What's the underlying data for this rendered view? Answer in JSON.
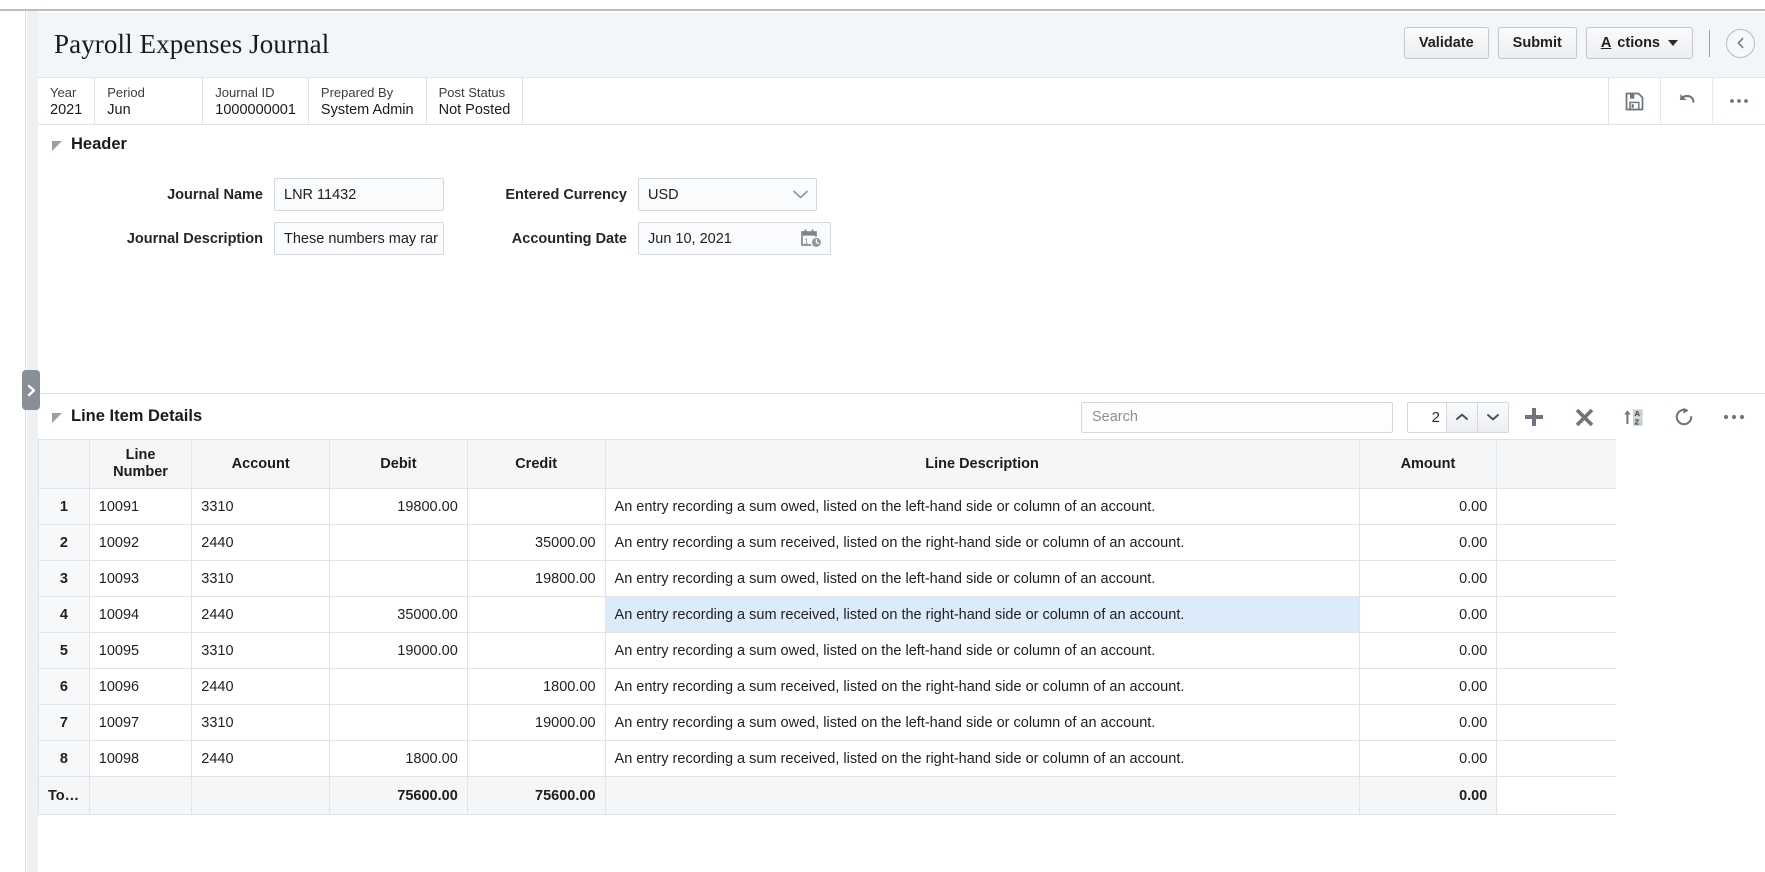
{
  "page": {
    "title": "Payroll Expenses Journal"
  },
  "title_actions": {
    "validate_label": "Validate",
    "submit_label": "Submit",
    "actions_label": "Actions",
    "actions_accesskey": "A",
    "actions_rest": "ctions"
  },
  "info_strip": {
    "fields": [
      {
        "label": "Year",
        "value": "2021"
      },
      {
        "label": "Period",
        "value": "Jun"
      },
      {
        "label": "Journal ID",
        "value": "1000000001"
      },
      {
        "label": "Prepared By",
        "value": "System Admin"
      },
      {
        "label": "Post Status",
        "value": "Not Posted"
      }
    ],
    "icons": [
      "save-icon",
      "undo-icon",
      "more-icon"
    ]
  },
  "header_section": {
    "title": "Header",
    "journal_name": {
      "label": "Journal Name",
      "value": "LNR 11432"
    },
    "journal_description": {
      "label": "Journal Description",
      "value": "These numbers may rar"
    },
    "entered_currency": {
      "label": "Entered Currency",
      "value": "USD",
      "options": [
        "USD"
      ]
    },
    "accounting_date": {
      "label": "Accounting Date",
      "value": "Jun 10, 2021"
    }
  },
  "line_items": {
    "title": "Line Item Details",
    "search": {
      "placeholder": "Search",
      "value": ""
    },
    "stepper": {
      "value": "2"
    },
    "toolbar_icons": [
      "add-icon",
      "delete-icon",
      "sort-az-icon",
      "refresh-icon",
      "more-icon"
    ],
    "columns": [
      "",
      "Line Number",
      "Account",
      "Debit",
      "Credit",
      "Line Description",
      "Amount"
    ],
    "rows": [
      {
        "idx": "1",
        "line_number": "10091",
        "account": "3310",
        "debit": "19800.00",
        "credit": "",
        "description": "An entry recording a sum owed, listed on the left-hand side or column of an account.",
        "amount": "0.00",
        "selected": false
      },
      {
        "idx": "2",
        "line_number": "10092",
        "account": "2440",
        "debit": "",
        "credit": "35000.00",
        "description": "An entry recording a sum received, listed on the right-hand side or column of an account.",
        "amount": "0.00",
        "selected": false
      },
      {
        "idx": "3",
        "line_number": "10093",
        "account": "3310",
        "debit": "",
        "credit": "19800.00",
        "description": "An entry recording a sum owed, listed on the left-hand side or column of an account.",
        "amount": "0.00",
        "selected": false
      },
      {
        "idx": "4",
        "line_number": "10094",
        "account": "2440",
        "debit": "35000.00",
        "credit": "",
        "description": "An entry recording a sum received, listed on the right-hand side or column of an account.",
        "amount": "0.00",
        "selected": true
      },
      {
        "idx": "5",
        "line_number": "10095",
        "account": "3310",
        "debit": "19000.00",
        "credit": "",
        "description": "An entry recording a sum owed, listed on the left-hand side or column of an account.",
        "amount": "0.00",
        "selected": false
      },
      {
        "idx": "6",
        "line_number": "10096",
        "account": "2440",
        "debit": "",
        "credit": "1800.00",
        "description": "An entry recording a sum received, listed on the right-hand side or column of an account.",
        "amount": "0.00",
        "selected": false
      },
      {
        "idx": "7",
        "line_number": "10097",
        "account": "3310",
        "debit": "",
        "credit": "19000.00",
        "description": "An entry recording a sum owed, listed on the left-hand side or column of an account.",
        "amount": "0.00",
        "selected": false
      },
      {
        "idx": "8",
        "line_number": "10098",
        "account": "2440",
        "debit": "1800.00",
        "credit": "",
        "description": "An entry recording a sum received, listed on the right-hand side or column of an account.",
        "amount": "0.00",
        "selected": false
      }
    ],
    "total": {
      "label": "Total",
      "line_number": "",
      "account": "",
      "debit": "75600.00",
      "credit": "75600.00",
      "description": "",
      "amount": "0.00"
    }
  },
  "colors": {
    "title_bar_bg": "#f3f6f8",
    "selection_bg": "#dbebf9",
    "header_row_bg": "#f4f6f8",
    "border": "#e0e4e8"
  }
}
